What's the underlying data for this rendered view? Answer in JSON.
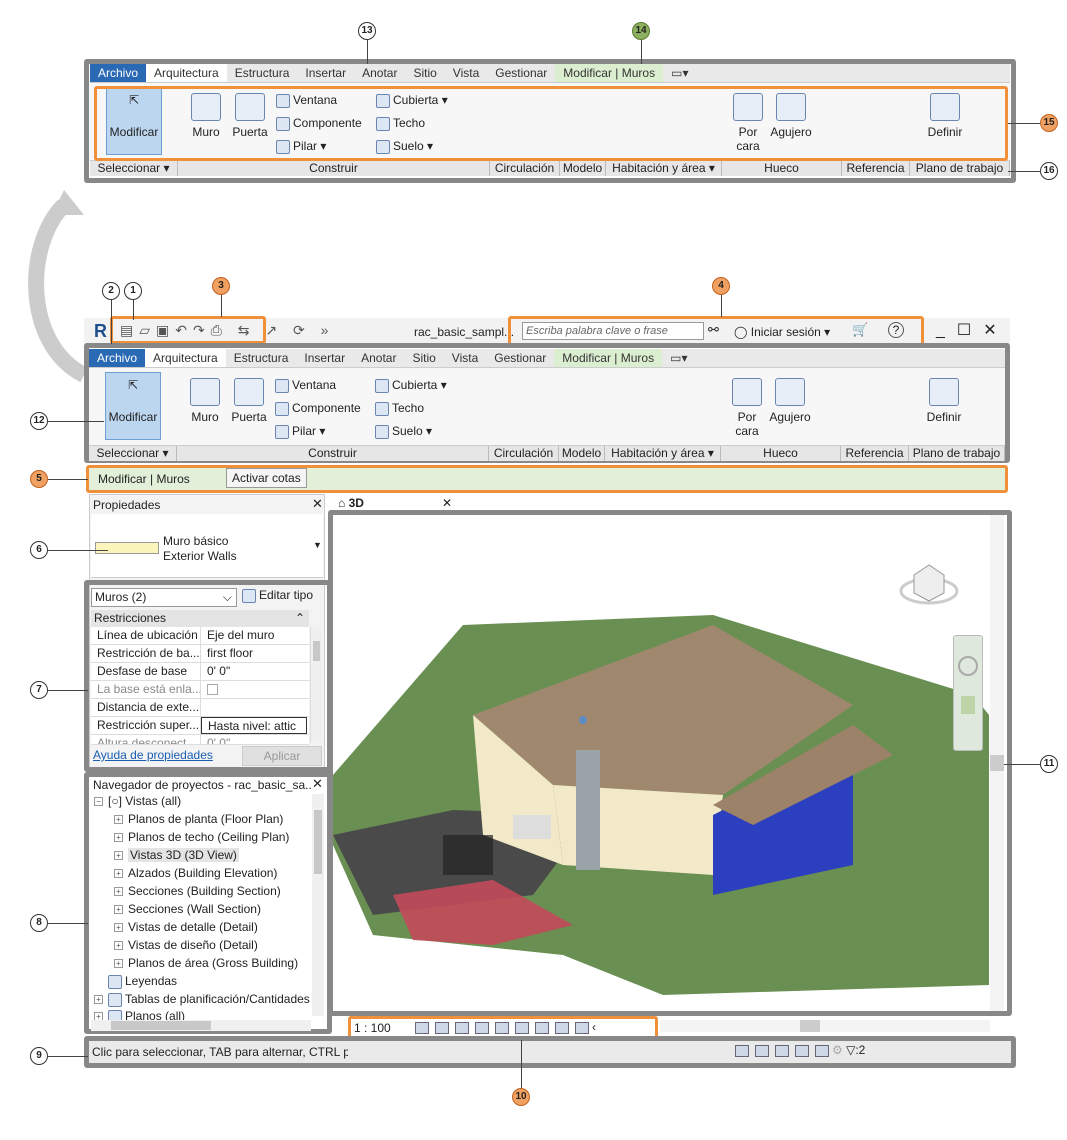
{
  "ribbon_tabs": [
    "Archivo",
    "Arquitectura",
    "Estructura",
    "Insertar",
    "Anotar",
    "Sitio",
    "Vista",
    "Gestionar",
    "Modificar | Muros"
  ],
  "ribbon": {
    "select": "Modificar",
    "muro": "Muro",
    "puerta": "Puerta",
    "ventana": "Ventana",
    "componente": "Componente",
    "pilar": "Pilar",
    "cubierta": "Cubierta",
    "techo": "Techo",
    "suelo": "Suelo",
    "por": "Por",
    "cara": "cara",
    "agujero": "Agujero",
    "definir": "Definir"
  },
  "panels": [
    "Seleccionar",
    "Construir",
    "Circulación",
    "Modelo",
    "Habitación y área",
    "Hueco",
    "Referencia",
    "Plano de trabajo"
  ],
  "qat": {
    "filename": "rac_basic_sampl...",
    "search_placeholder": "Escriba palabra clave o frase",
    "signin": "Iniciar sesión"
  },
  "options_bar": {
    "context": "Modificar | Muros",
    "button": "Activar cotas"
  },
  "properties": {
    "title": "Propiedades",
    "type_name1": "Muro básico",
    "type_name2": "Exterior Walls",
    "filter": "Muros (2)",
    "edit_type": "Editar tipo",
    "group": "Restricciones",
    "rows": [
      {
        "label": "Línea de ubicación",
        "value": "Eje del muro"
      },
      {
        "label": "Restricción de ba...",
        "value": "first floor"
      },
      {
        "label": "Desfase de base",
        "value": "0'  0\""
      },
      {
        "label": "La base está enla...",
        "value": ""
      },
      {
        "label": "Distancia de exte...",
        "value": ""
      },
      {
        "label": "Restricción super...",
        "value": "Hasta nivel: attic"
      },
      {
        "label": "Altura desconect...",
        "value": "0'  0\""
      }
    ],
    "help": "Ayuda de propiedades",
    "apply": "Aplicar"
  },
  "browser": {
    "title": "Navegador de proyectos - rac_basic_sa...",
    "root": "Vistas (all)",
    "items": [
      "Planos de planta (Floor Plan)",
      "Planos de techo (Ceiling Plan)",
      "Vistas 3D (3D View)",
      "Alzados (Building Elevation)",
      "Secciones (Building Section)",
      "Secciones (Wall Section)",
      "Vistas de detalle (Detail)",
      "Vistas de diseño (Detail)",
      "Planos de área (Gross Building)"
    ],
    "after": [
      "Leyendas",
      "Tablas de planificación/Cantidades",
      "Planos (all)"
    ]
  },
  "view": {
    "tab": "3D",
    "scale": "1 : 100"
  },
  "status": {
    "text": "Clic para seleccionar, TAB para alternar, CTRL par",
    "filter_count": ":2"
  },
  "callouts": [
    "1",
    "2",
    "3",
    "4",
    "5",
    "6",
    "7",
    "8",
    "9",
    "10",
    "11",
    "12",
    "13",
    "14",
    "15",
    "16"
  ]
}
